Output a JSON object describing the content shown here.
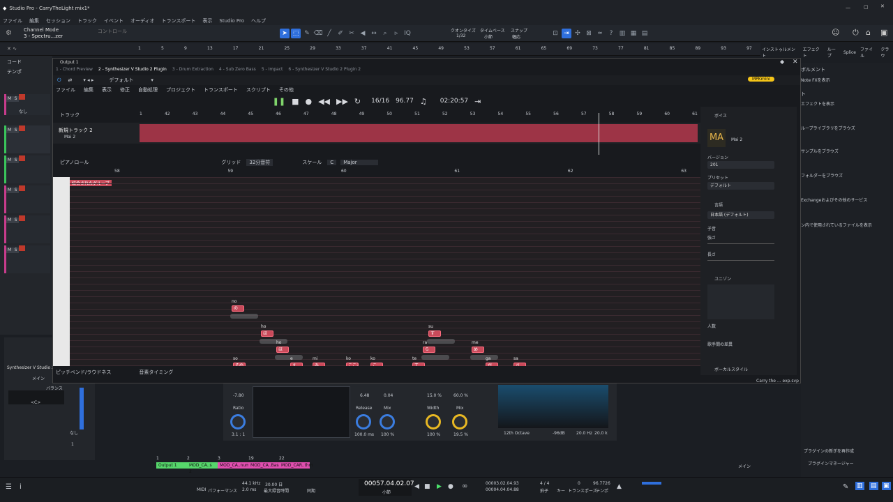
{
  "window": {
    "title": "Studio Pro - CarryTheLight mix1*"
  },
  "menu": [
    "ファイル",
    "編集",
    "セッション",
    "トラック",
    "イベント",
    "オーディオ",
    "トランスポート",
    "表示",
    "Studio Pro",
    "ヘルプ"
  ],
  "channel": {
    "mode": "Channel Mode",
    "name": "3 - Spectru...zer",
    "control": "コントロール"
  },
  "toolbar": {
    "quantize_label": "クオンタイズ",
    "quantize_value": "1/32",
    "timebase_label": "タイムベース",
    "timebase_value": "小節",
    "snap_label": "スナップ",
    "snap_value": "幅応"
  },
  "ruler": {
    "marks": [
      "1",
      "5",
      "9",
      "13",
      "17",
      "21",
      "25",
      "29",
      "33",
      "37",
      "41",
      "45",
      "49",
      "53",
      "57",
      "61",
      "65",
      "69",
      "73",
      "77",
      "81",
      "85",
      "89",
      "93",
      "97"
    ]
  },
  "right_tabs": [
    "インストゥルメント",
    "エフェクト",
    "ループ",
    "Splice",
    "ファイル",
    "クラウ"
  ],
  "tracks": {
    "code": "コード",
    "tempo": "テンポ",
    "none": "なし"
  },
  "plugin": {
    "output_title": "Output 1",
    "tabs": [
      "1 - Chord Preview",
      "2 - Synthesizer V Studio 2 Plugin",
      "3 - Drum Extraction",
      "4 - Sub Zero Bass",
      "5 - Impact",
      "6 - Synthesizer V Studio 2 Plugin 2"
    ],
    "preset": "デフォルト",
    "menu": [
      "ファイル",
      "編集",
      "表示",
      "修正",
      "自動処理",
      "プロジェクト",
      "トランスポート",
      "スクリプト",
      "その他"
    ],
    "badge": "MPKmini",
    "transport": {
      "position": "16/16",
      "tempo": "96.77",
      "time": "02:20:57"
    },
    "track_label": "トラック",
    "timeline": [
      "1",
      "42",
      "43",
      "44",
      "45",
      "46",
      "47",
      "48",
      "49",
      "50",
      "51",
      "52",
      "53",
      "54",
      "55",
      "56",
      "57",
      "58",
      "59",
      "60",
      "61"
    ],
    "track_name": "新規トラック 2",
    "voice": "Mai 2",
    "piano_roll": {
      "label": "ピアノロール",
      "grid_label": "グリッド",
      "grid_value": "32分音符",
      "scale_label": "スケール",
      "key": "C",
      "mode": "Major",
      "bars": [
        "58",
        "59",
        "60",
        "61",
        "62",
        "63"
      ]
    },
    "group_label": "結合されたグループ",
    "bottom_tabs": [
      "ピッチベンド/ラウドネス",
      "音素タイミング"
    ],
    "notes": [
      {
        "lyric": "no",
        "text": "の",
        "l": 256,
        "t": 184
      },
      {
        "lyric": "ho",
        "text": "ほ",
        "l": 298,
        "t": 220
      },
      {
        "lyric": "ho",
        "text": "ほ",
        "l": 320,
        "t": 243
      },
      {
        "lyric": "so",
        "text": "その",
        "l": 258,
        "t": 266
      },
      {
        "lyric": "e",
        "text": "え",
        "l": 340,
        "t": 266
      },
      {
        "lyric": "mi",
        "text": "み",
        "l": 372,
        "t": 266
      },
      {
        "lyric": "ko",
        "text": "こころ",
        "l": 420,
        "t": 266
      },
      {
        "lyric": "ko",
        "text": "こ",
        "l": 455,
        "t": 266
      },
      {
        "lyric": "te",
        "text": "て",
        "l": 515,
        "t": 266
      },
      {
        "lyric": "ra",
        "text": "ら",
        "l": 530,
        "t": 243
      },
      {
        "lyric": "su",
        "text": "す",
        "l": 538,
        "t": 220
      },
      {
        "lyric": "me",
        "text": "め",
        "l": 600,
        "t": 243
      },
      {
        "lyric": "ga",
        "text": "が",
        "l": 620,
        "t": 266
      },
      {
        "lyric": "sa",
        "text": "さ",
        "l": 660,
        "t": 266
      },
      {
        "lyric": "mi",
        "text": "み",
        "l": 637,
        "t": 302
      },
      {
        "lyric": "wa",
        "text": "わ",
        "l": 398,
        "t": 325
      },
      {
        "lyric": "ro",
        "text": "ろ",
        "l": 494,
        "t": 325
      },
      {
        "lyric": "e",
        "text": "え",
        "l": 20,
        "t": 302
      }
    ],
    "right": {
      "voice_label": "ボイス",
      "singer": "Mai 2",
      "version_label": "バージョン",
      "version": "201",
      "preset_label": "プリセット",
      "preset": "デフォルト",
      "lang_label": "言語",
      "lang": "日本語 (デフォルト)",
      "consonant": "子音",
      "strength": "強さ",
      "length": "長さ",
      "unison": "ユニゾン",
      "count": "人数",
      "voices_label": "歌手間の差異",
      "vocal_style": "ボーカルスタイル"
    },
    "file": "Carry the ... exp.svp"
  },
  "browser_side": {
    "items": [
      "ボルメント",
      "ト",
      "Note FXを表示",
      "エフェクトを表示",
      "ループライブラリをブラウズ",
      "サンプルをブラウズ",
      "フォルダーをブラウズ",
      "Exchangeおよびその他のサービス",
      "ン内で使用されているファイルを表示"
    ],
    "plugin_reset": "プラグインの新ぎを再作成",
    "manager": "プラグインマネージャー"
  },
  "mixer": {
    "labels": [
      "Ratio",
      "Release",
      "Mix",
      "Width",
      "Mix"
    ],
    "values": [
      "-7.80",
      "6.48",
      "0.04",
      "15.0 %",
      "60.0 %",
      "3.1 : 1",
      "100.0 ms",
      "100 %",
      "100 %",
      "19.5 %"
    ],
    "analyzer": [
      "12th Octave",
      "-96dB",
      "20.0 Hz",
      "20.0 k"
    ]
  },
  "left_insp": {
    "plugin": "Synthesizer V Studio 2 Pl",
    "main": "メイン",
    "balance": "バランス",
    "center": "<C>",
    "none": "なし",
    "num": "1"
  },
  "clips": [
    {
      "label": "Output 1",
      "color": "#56d66b"
    },
    {
      "label": "MOD_CA..s 2",
      "color": "#56d66b"
    },
    {
      "label": "MOD_CA..nums",
      "color": "#e14fb0"
    },
    {
      "label": "MOD_CA..Bass",
      "color": "#e14fb0"
    },
    {
      "label": "MOD_CAR..thm",
      "color": "#e14fb0"
    }
  ],
  "clip_nums": [
    "1",
    "2",
    "3",
    "19",
    "22"
  ],
  "main_label": "メイン",
  "status": {
    "midi": "MIDI",
    "perf": "パフォーマンス",
    "rate": "44.1 kHz",
    "latency": "2.0 ms",
    "dur": "30.00 日",
    "maxrec": "最大録音時間",
    "sync": "同期",
    "position": "00057.04.02.07",
    "unit": "小節",
    "l": "00003.02.04.93",
    "r": "00004.04.04.88",
    "sig": "4 / 4",
    "sig_label": "拍子",
    "key_label": "キー",
    "transpose": "0",
    "transpose_label": "トランスポーズ",
    "tempo": "96.7726",
    "tempo_label": "テンポ"
  }
}
